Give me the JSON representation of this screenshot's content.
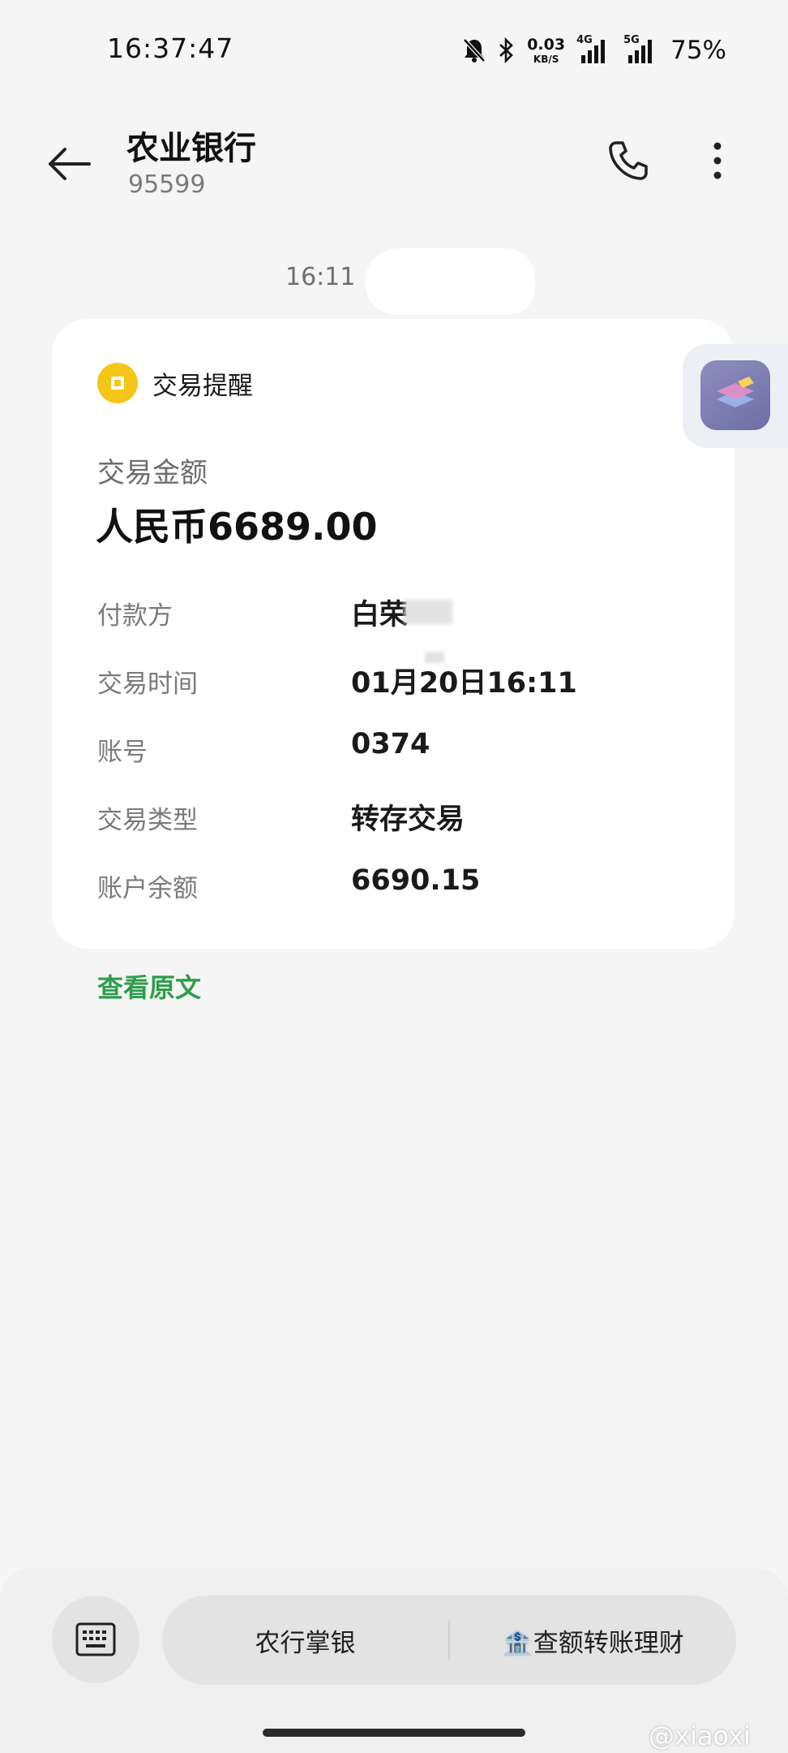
{
  "status_bar": {
    "time": "16:37:47",
    "net_speed": "0.03",
    "net_unit": "KB/S",
    "signal_1_gen": "4G",
    "signal_2_gen": "5G",
    "battery": "75%"
  },
  "header": {
    "title": "农业银行",
    "subtitle": "95599"
  },
  "message_time": "16:11",
  "card": {
    "heading": "交易提醒",
    "amount_label": "交易金额",
    "amount_value": "人民币6689.00",
    "rows": [
      {
        "label": "付款方",
        "value": "白荣"
      },
      {
        "label": "交易时间",
        "value": "01月20日16:11"
      },
      {
        "label": "账号",
        "value": "0374"
      },
      {
        "label": "交易类型",
        "value": "转存交易"
      },
      {
        "label": "账户余额",
        "value": "6690.15"
      }
    ]
  },
  "view_original": "查看原文",
  "quick_menu": {
    "item_1": "农行掌银",
    "item_2": "🏦查额转账理财"
  },
  "watermark": "@xiaoxi",
  "colors": {
    "accent_green": "#2e9d4a",
    "bank_icon_yellow": "#f5c518",
    "background": "#f5f5f5"
  }
}
